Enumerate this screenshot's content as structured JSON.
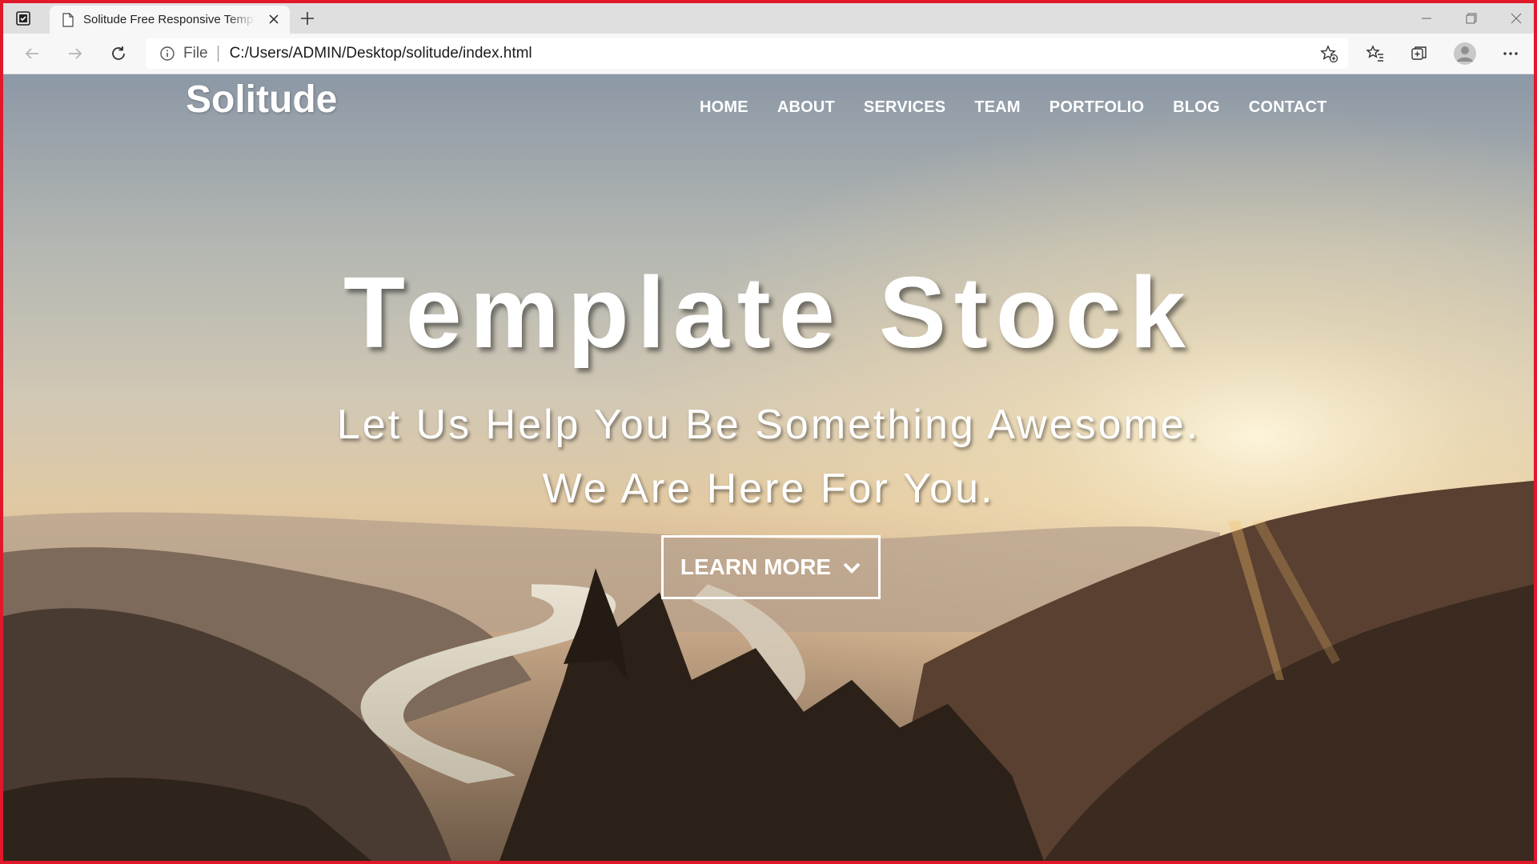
{
  "browser": {
    "tab": {
      "title": "Solitude Free Responsive Template"
    },
    "address": {
      "scheme": "File",
      "url": "C:/Users/ADMIN/Desktop/solitude/index.html"
    },
    "accent_frame_color": "#e0182a"
  },
  "site": {
    "logo": "Solitude",
    "nav": [
      "HOME",
      "ABOUT",
      "SERVICES",
      "TEAM",
      "PORTFOLIO",
      "BLOG",
      "CONTACT"
    ],
    "hero": {
      "title": "Template Stock",
      "subtitle_line1": "Let Us Help You Be Something Awesome.",
      "subtitle_line2": "We Are Here For You.",
      "cta": "LEARN MORE"
    }
  },
  "icons": {
    "tab_actions": "tab-actions-icon",
    "page": "page-icon",
    "close": "close-icon",
    "new_tab": "plus-icon",
    "back": "back-arrow-icon",
    "forward": "forward-arrow-icon",
    "refresh": "refresh-icon",
    "info": "info-icon",
    "add_favorite": "star-plus-icon",
    "favorites": "favorites-icon",
    "collections": "collections-icon",
    "profile": "profile-icon",
    "menu": "more-icon",
    "cta_chevron": "chevron-down-icon"
  }
}
